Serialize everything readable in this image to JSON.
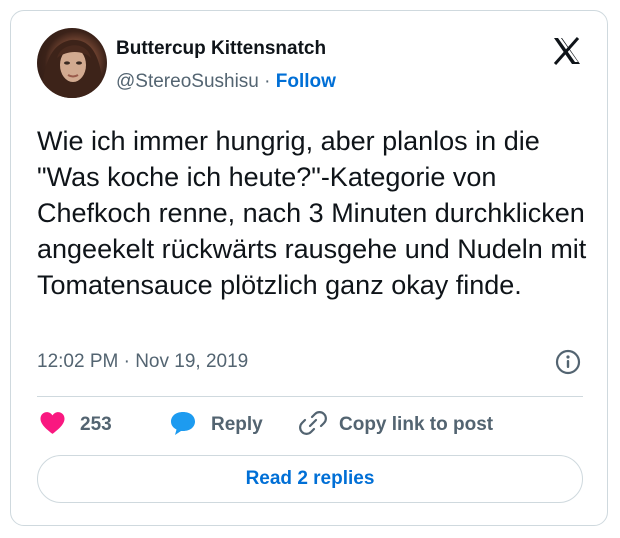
{
  "author": {
    "display_name": "Buttercup Kittensnatch",
    "handle": "@StereoSushisu",
    "separator": "·",
    "follow_label": "Follow"
  },
  "tweet": {
    "text": "Wie ich immer hungrig, aber planlos in die \"Was koche ich heute?\"-Kategorie von Chefkoch renne, nach 3 Minuten durchklicken angeekelt rückwärts rausgehe und Nudeln mit Tomatensauce plötzlich ganz okay finde.",
    "timestamp": "12:02 PM · Nov 19, 2019"
  },
  "actions": {
    "like_count": "253",
    "reply_label": "Reply",
    "copy_link_label": "Copy link to post"
  },
  "read_replies_label": "Read 2 replies",
  "icons": {
    "brand": "x-logo-icon",
    "info": "info-icon",
    "like": "heart-icon",
    "reply": "speech-bubble-icon",
    "copy": "link-icon"
  },
  "colors": {
    "accent": "#006fd6",
    "like": "#f91880",
    "reply_icon": "#1d9bf0",
    "secondary_text": "#536471",
    "border": "#cfd9de"
  }
}
